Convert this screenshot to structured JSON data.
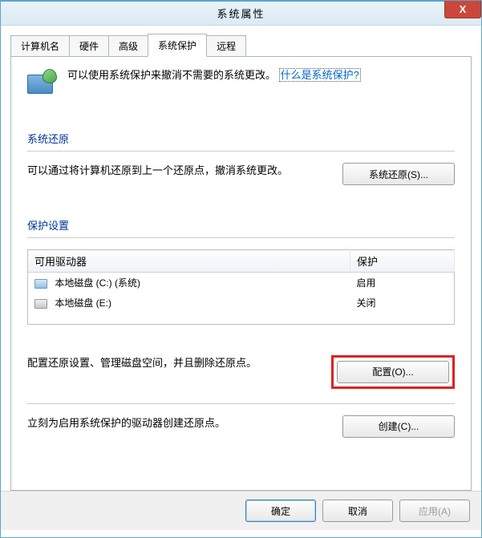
{
  "window": {
    "title": "系统属性",
    "close_glyph": "X"
  },
  "tabs": {
    "items": [
      {
        "label": "计算机名",
        "active": false
      },
      {
        "label": "硬件",
        "active": false
      },
      {
        "label": "高级",
        "active": false
      },
      {
        "label": "系统保护",
        "active": true
      },
      {
        "label": "远程",
        "active": false
      }
    ]
  },
  "intro": {
    "text": "可以使用系统保护来撤消不需要的系统更改。",
    "link": "什么是系统保护?"
  },
  "restore_section": {
    "header": "系统还原",
    "text": "可以通过将计算机还原到上一个还原点，撤消系统更改。",
    "button": "系统还原(S)..."
  },
  "protection_section": {
    "header": "保护设置",
    "columns": {
      "drive": "可用驱动器",
      "status": "保护"
    },
    "rows": [
      {
        "name": "本地磁盘 (C:) (系统)",
        "status": "启用",
        "icon": "primary"
      },
      {
        "name": "本地磁盘 (E:)",
        "status": "关闭",
        "icon": "secondary"
      }
    ],
    "config_text": "配置还原设置、管理磁盘空间，并且删除还原点。",
    "config_button": "配置(O)...",
    "create_text": "立刻为启用系统保护的驱动器创建还原点。",
    "create_button": "创建(C)..."
  },
  "buttons": {
    "ok": "确定",
    "cancel": "取消",
    "apply": "应用(A)"
  }
}
